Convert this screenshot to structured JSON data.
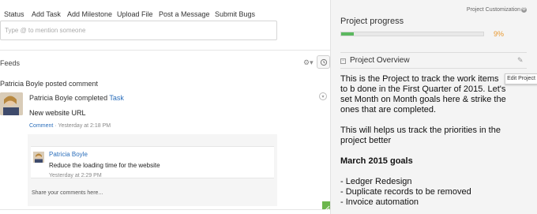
{
  "toolbar": {
    "tabs": [
      "Status",
      "Add Task",
      "Add Milestone",
      "Upload File",
      "Post a Message",
      "Submit Bugs"
    ]
  },
  "composer": {
    "placeholder": "Type @ to mention someone"
  },
  "feeds": {
    "title": "Feeds",
    "gear_icon": "gear-icon",
    "history_icon": "history-icon",
    "post": {
      "header": "Patricia Boyle posted comment",
      "author": "Patricia Boyle",
      "action": "completed",
      "link": "Task",
      "title": "New website URL",
      "comment_link": "Comment",
      "meta": " · Yesterday at 2:18 PM",
      "comment": {
        "author": "Patricia Boyle",
        "text": "Reduce the loading time for the website",
        "time": "Yesterday at 2:29 PM"
      },
      "reply_placeholder": "Share your comments here..."
    }
  },
  "sidebar": {
    "customization": "Project Customization",
    "progress": {
      "title": "Project progress",
      "value": 9,
      "label": "9%",
      "color": "#5cb860"
    },
    "overview": {
      "title": "Project Overview",
      "tooltip": "Edit Project",
      "paragraph1": "This is the Project to track the work items to b done in the First Quarter of 2015. Let's set Month on Month goals here & strike the ones that are completed.",
      "paragraph2": "This will helps us track the priorities in the project better",
      "heading": "March 2015 goals",
      "items": [
        "- Ledger Redesign",
        "- Duplicate records to be removed",
        "- Invoice automation"
      ]
    }
  }
}
